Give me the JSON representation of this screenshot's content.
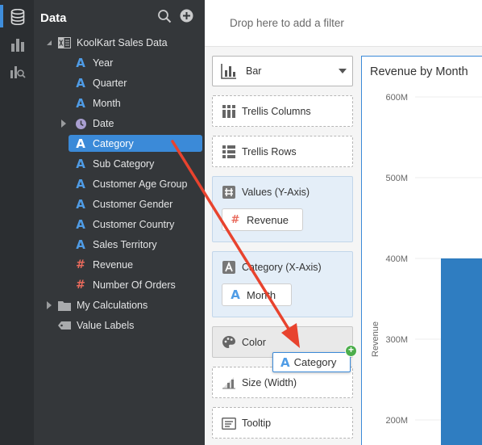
{
  "tree": {
    "title": "Data",
    "root": "KoolKart Sales Data",
    "items": [
      {
        "label": "Year",
        "type": "attribute"
      },
      {
        "label": "Quarter",
        "type": "attribute"
      },
      {
        "label": "Month",
        "type": "attribute"
      },
      {
        "label": "Date",
        "type": "time"
      },
      {
        "label": "Category",
        "type": "attribute"
      },
      {
        "label": "Sub Category",
        "type": "attribute"
      },
      {
        "label": "Customer Age Group",
        "type": "attribute"
      },
      {
        "label": "Customer Gender",
        "type": "attribute"
      },
      {
        "label": "Customer Country",
        "type": "attribute"
      },
      {
        "label": "Sales Territory",
        "type": "attribute"
      },
      {
        "label": "Revenue",
        "type": "measure"
      },
      {
        "label": "Number Of Orders",
        "type": "measure"
      }
    ],
    "my_calculations": "My Calculations",
    "value_labels": "Value Labels"
  },
  "filter_bar": {
    "placeholder": "Drop here to add a filter"
  },
  "grammar": {
    "chart_type": "Bar",
    "trellis_columns": "Trellis Columns",
    "trellis_rows": "Trellis Rows",
    "values": "Values (Y-Axis)",
    "values_pill": "Revenue",
    "category": "Category (X-Axis)",
    "category_pill": "Month",
    "color": "Color",
    "size": "Size (Width)",
    "tooltip": "Tooltip"
  },
  "drag_ghost": {
    "label": "Category"
  },
  "chart": {
    "title": "Revenue by Month"
  },
  "chart_data": {
    "type": "bar",
    "title": "Revenue by Month",
    "ylabel": "Revenue",
    "yticks": [
      "600M",
      "500M",
      "400M",
      "300M",
      "200M"
    ],
    "ylim": [
      200000000,
      600000000
    ],
    "visible_bar_values": [
      400000000
    ],
    "bar_color": "#2f7dc1"
  },
  "colors": {
    "accent": "#3b8ad8",
    "attribute": "#4f9ce6",
    "measure": "#e86a5c",
    "arrow": "#e8432e"
  }
}
